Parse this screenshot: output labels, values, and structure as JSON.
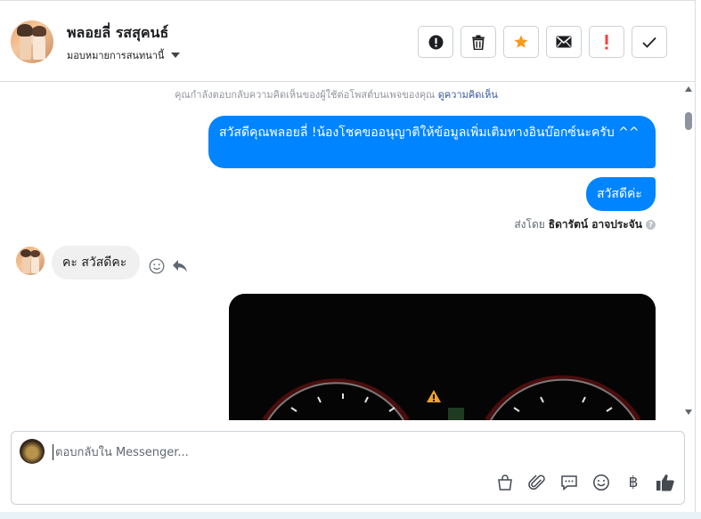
{
  "header": {
    "contact_name": "พลอยลี่ รสสุคนธ์",
    "assign_label": "มอบหมายการสนทนานี้",
    "toolbar": [
      {
        "name": "mark-spam",
        "icon": "alert-circle-icon"
      },
      {
        "name": "delete",
        "icon": "trash-icon"
      },
      {
        "name": "star",
        "icon": "star-icon"
      },
      {
        "name": "mark-unread",
        "icon": "envelope-icon"
      },
      {
        "name": "follow-up",
        "icon": "exclamation-icon"
      },
      {
        "name": "done",
        "icon": "checkmark-icon"
      }
    ]
  },
  "conversation": {
    "notice_text": "คุณกำลังตอบกลับความคิดเห็นของผู้ใช้ต่อโพสต์บนเพจของคุณ",
    "notice_link": "ดูความคิดเห็น",
    "messages": [
      {
        "direction": "out",
        "text": "สวัสดีคุณพลอยลี่ !น้องโชคขออนุญาติให้ข้อมูลเพิ่มเติมทางอินบ๊อกซ์นะครับ ^^"
      },
      {
        "direction": "out",
        "text": "สวัสดีค่ะ"
      },
      {
        "direction": "in",
        "text": "คะ สวัสดีคะ"
      }
    ],
    "sent_by_prefix": "ส่งโดย",
    "sent_by_name": "ธิดารัตน์ อาจประจัน",
    "help_glyph": "?"
  },
  "composer": {
    "placeholder": "ตอบกลับใน Messenger...",
    "tools": [
      "bag-icon",
      "paperclip-icon",
      "saved-reply-icon",
      "emoji-icon",
      "baht-icon",
      "thumbs-up-icon"
    ],
    "baht_glyph": "฿"
  },
  "colors": {
    "accent": "#0084ff",
    "star": "#f79a1e",
    "follow_up": "#fa3e3e"
  }
}
